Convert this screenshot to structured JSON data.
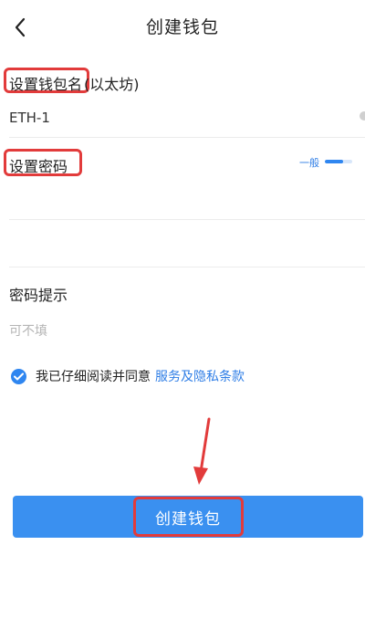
{
  "header": {
    "title": "创建钱包",
    "back_icon": "chevron-left-icon"
  },
  "wallet_name": {
    "label": "设置钱包名",
    "suffix": "(以太坊)",
    "value": "ETH-1"
  },
  "password": {
    "label": "设置密码",
    "strength_label": "一般",
    "strength_level": 0.65
  },
  "hint": {
    "label": "密码提示",
    "placeholder": "可不填"
  },
  "agreement": {
    "text": "我已仔细阅读并同意",
    "link": "服务及隐私条款",
    "checked": true
  },
  "actions": {
    "create_label": "创建钱包"
  },
  "colors": {
    "accent": "#3a90f0",
    "link": "#2f7ee6",
    "annotation_red": "#e23b3b"
  }
}
